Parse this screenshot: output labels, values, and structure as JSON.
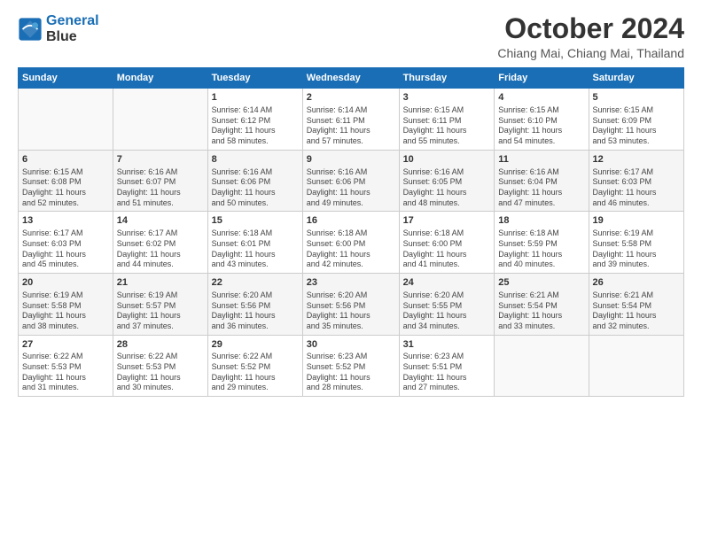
{
  "header": {
    "logo": {
      "line1": "General",
      "line2": "Blue"
    },
    "title": "October 2024",
    "location": "Chiang Mai, Chiang Mai, Thailand"
  },
  "weekdays": [
    "Sunday",
    "Monday",
    "Tuesday",
    "Wednesday",
    "Thursday",
    "Friday",
    "Saturday"
  ],
  "weeks": [
    [
      {
        "day": "",
        "info": ""
      },
      {
        "day": "",
        "info": ""
      },
      {
        "day": "1",
        "info": "Sunrise: 6:14 AM\nSunset: 6:12 PM\nDaylight: 11 hours\nand 58 minutes."
      },
      {
        "day": "2",
        "info": "Sunrise: 6:14 AM\nSunset: 6:11 PM\nDaylight: 11 hours\nand 57 minutes."
      },
      {
        "day": "3",
        "info": "Sunrise: 6:15 AM\nSunset: 6:11 PM\nDaylight: 11 hours\nand 55 minutes."
      },
      {
        "day": "4",
        "info": "Sunrise: 6:15 AM\nSunset: 6:10 PM\nDaylight: 11 hours\nand 54 minutes."
      },
      {
        "day": "5",
        "info": "Sunrise: 6:15 AM\nSunset: 6:09 PM\nDaylight: 11 hours\nand 53 minutes."
      }
    ],
    [
      {
        "day": "6",
        "info": "Sunrise: 6:15 AM\nSunset: 6:08 PM\nDaylight: 11 hours\nand 52 minutes."
      },
      {
        "day": "7",
        "info": "Sunrise: 6:16 AM\nSunset: 6:07 PM\nDaylight: 11 hours\nand 51 minutes."
      },
      {
        "day": "8",
        "info": "Sunrise: 6:16 AM\nSunset: 6:06 PM\nDaylight: 11 hours\nand 50 minutes."
      },
      {
        "day": "9",
        "info": "Sunrise: 6:16 AM\nSunset: 6:06 PM\nDaylight: 11 hours\nand 49 minutes."
      },
      {
        "day": "10",
        "info": "Sunrise: 6:16 AM\nSunset: 6:05 PM\nDaylight: 11 hours\nand 48 minutes."
      },
      {
        "day": "11",
        "info": "Sunrise: 6:16 AM\nSunset: 6:04 PM\nDaylight: 11 hours\nand 47 minutes."
      },
      {
        "day": "12",
        "info": "Sunrise: 6:17 AM\nSunset: 6:03 PM\nDaylight: 11 hours\nand 46 minutes."
      }
    ],
    [
      {
        "day": "13",
        "info": "Sunrise: 6:17 AM\nSunset: 6:03 PM\nDaylight: 11 hours\nand 45 minutes."
      },
      {
        "day": "14",
        "info": "Sunrise: 6:17 AM\nSunset: 6:02 PM\nDaylight: 11 hours\nand 44 minutes."
      },
      {
        "day": "15",
        "info": "Sunrise: 6:18 AM\nSunset: 6:01 PM\nDaylight: 11 hours\nand 43 minutes."
      },
      {
        "day": "16",
        "info": "Sunrise: 6:18 AM\nSunset: 6:00 PM\nDaylight: 11 hours\nand 42 minutes."
      },
      {
        "day": "17",
        "info": "Sunrise: 6:18 AM\nSunset: 6:00 PM\nDaylight: 11 hours\nand 41 minutes."
      },
      {
        "day": "18",
        "info": "Sunrise: 6:18 AM\nSunset: 5:59 PM\nDaylight: 11 hours\nand 40 minutes."
      },
      {
        "day": "19",
        "info": "Sunrise: 6:19 AM\nSunset: 5:58 PM\nDaylight: 11 hours\nand 39 minutes."
      }
    ],
    [
      {
        "day": "20",
        "info": "Sunrise: 6:19 AM\nSunset: 5:58 PM\nDaylight: 11 hours\nand 38 minutes."
      },
      {
        "day": "21",
        "info": "Sunrise: 6:19 AM\nSunset: 5:57 PM\nDaylight: 11 hours\nand 37 minutes."
      },
      {
        "day": "22",
        "info": "Sunrise: 6:20 AM\nSunset: 5:56 PM\nDaylight: 11 hours\nand 36 minutes."
      },
      {
        "day": "23",
        "info": "Sunrise: 6:20 AM\nSunset: 5:56 PM\nDaylight: 11 hours\nand 35 minutes."
      },
      {
        "day": "24",
        "info": "Sunrise: 6:20 AM\nSunset: 5:55 PM\nDaylight: 11 hours\nand 34 minutes."
      },
      {
        "day": "25",
        "info": "Sunrise: 6:21 AM\nSunset: 5:54 PM\nDaylight: 11 hours\nand 33 minutes."
      },
      {
        "day": "26",
        "info": "Sunrise: 6:21 AM\nSunset: 5:54 PM\nDaylight: 11 hours\nand 32 minutes."
      }
    ],
    [
      {
        "day": "27",
        "info": "Sunrise: 6:22 AM\nSunset: 5:53 PM\nDaylight: 11 hours\nand 31 minutes."
      },
      {
        "day": "28",
        "info": "Sunrise: 6:22 AM\nSunset: 5:53 PM\nDaylight: 11 hours\nand 30 minutes."
      },
      {
        "day": "29",
        "info": "Sunrise: 6:22 AM\nSunset: 5:52 PM\nDaylight: 11 hours\nand 29 minutes."
      },
      {
        "day": "30",
        "info": "Sunrise: 6:23 AM\nSunset: 5:52 PM\nDaylight: 11 hours\nand 28 minutes."
      },
      {
        "day": "31",
        "info": "Sunrise: 6:23 AM\nSunset: 5:51 PM\nDaylight: 11 hours\nand 27 minutes."
      },
      {
        "day": "",
        "info": ""
      },
      {
        "day": "",
        "info": ""
      }
    ]
  ]
}
